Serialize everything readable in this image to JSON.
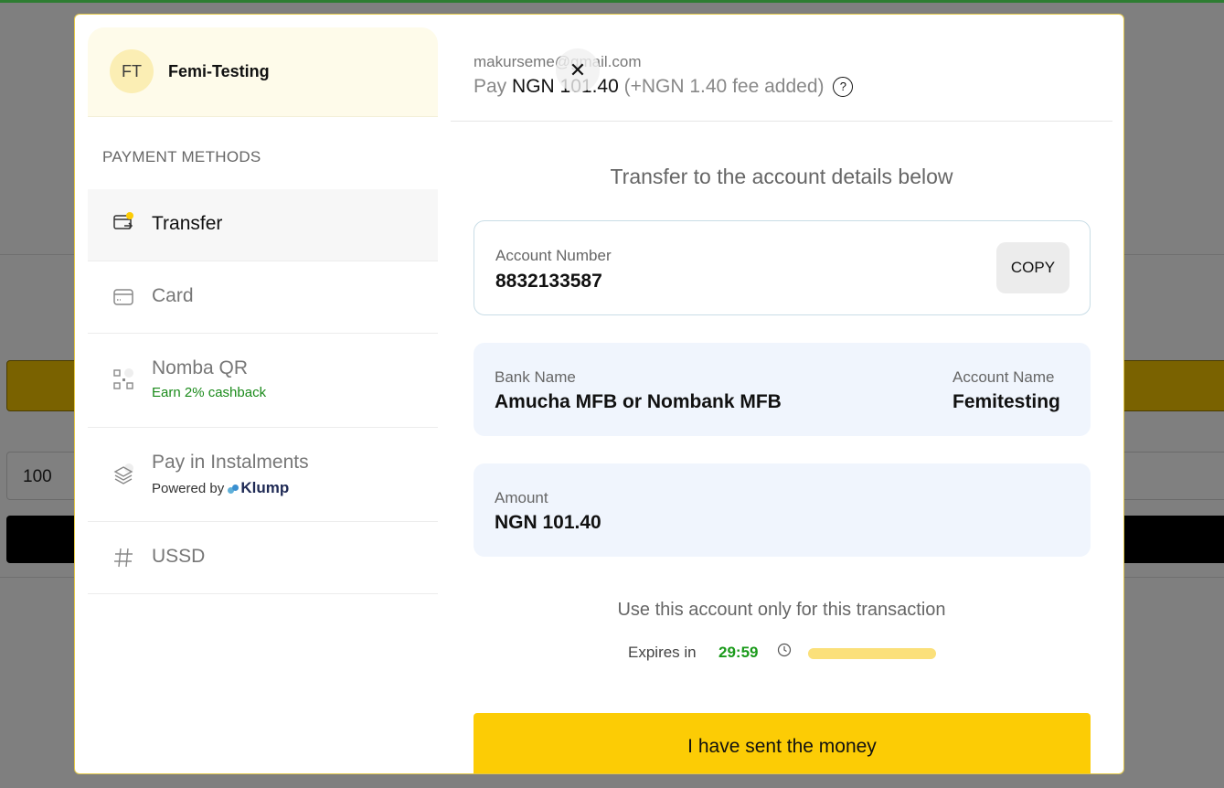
{
  "background": {
    "amount_input_value": "100"
  },
  "merchant": {
    "initials": "FT",
    "name": "Femi-Testing"
  },
  "sidebar": {
    "section_title": "PAYMENT METHODS",
    "methods": [
      {
        "label": "Transfer",
        "icon": "bank-transfer-icon",
        "active": true
      },
      {
        "label": "Card",
        "icon": "card-icon"
      },
      {
        "label": "Nomba QR",
        "icon": "qr-code-icon",
        "sub": "Earn 2% cashback"
      },
      {
        "label": "Pay in Instalments",
        "icon": "layers-icon",
        "sub_prefix": "Powered by",
        "sub_brand": "Klump"
      },
      {
        "label": "USSD",
        "icon": "hash-icon"
      }
    ]
  },
  "header": {
    "email": "makurseme@gmail.com",
    "pay_prefix": "Pay",
    "pay_amount": "NGN 101.40",
    "fee_note": "(+NGN 1.40 fee added)",
    "help_glyph": "?"
  },
  "transfer": {
    "heading": "Transfer to the account details below",
    "account_number_label": "Account Number",
    "account_number": "8832133587",
    "copy_label": "COPY",
    "bank_name_label": "Bank Name",
    "bank_name": "Amucha MFB or Nombank MFB",
    "account_name_label": "Account Name",
    "account_name": "Femitesting",
    "amount_label": "Amount",
    "amount": "NGN 101.40",
    "note": "Use this account only for this transaction",
    "expires_label": "Expires in",
    "timer": "29:59",
    "timer_progress_percent": 100,
    "cta": "I have sent the money"
  },
  "colors": {
    "accent": "#fccc05",
    "timer": "#1a9a1a",
    "cashback": "#1a8a1a"
  }
}
